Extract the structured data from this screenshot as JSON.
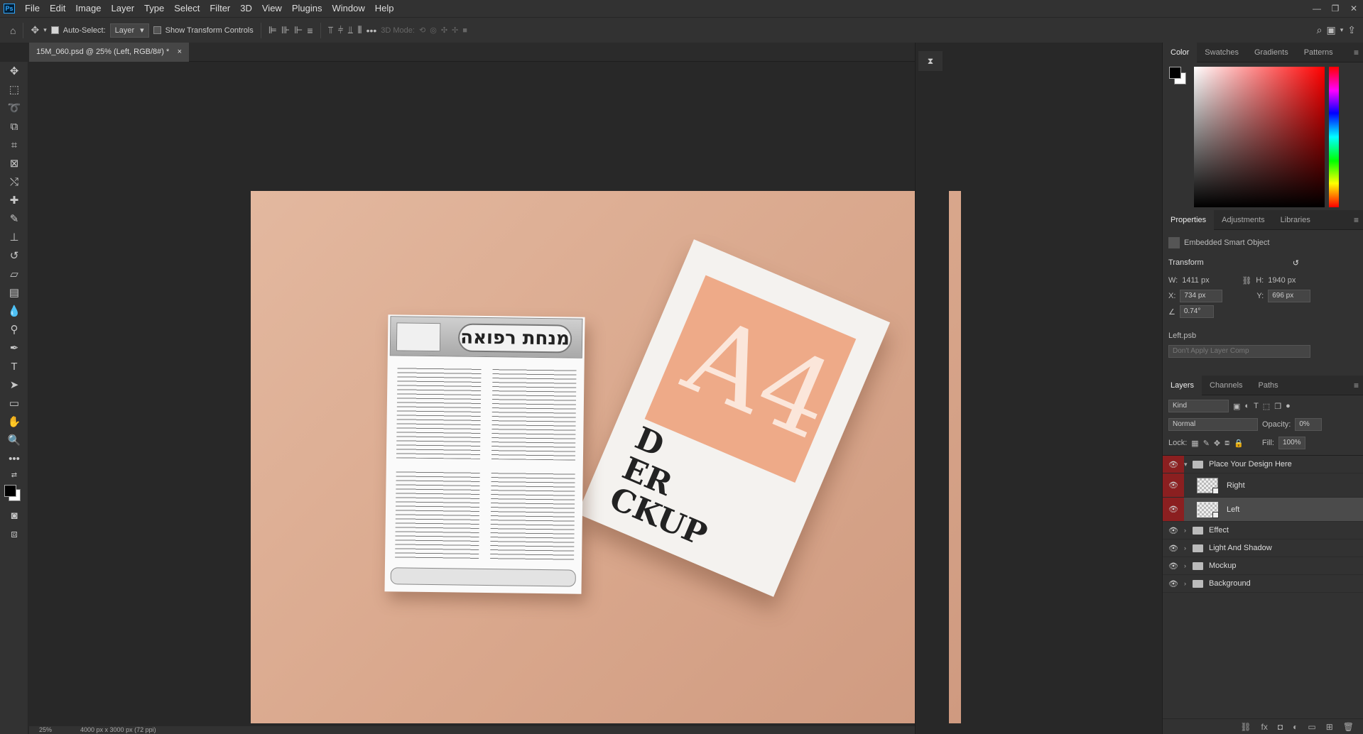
{
  "menubar": {
    "items": [
      "File",
      "Edit",
      "Image",
      "Layer",
      "Type",
      "Select",
      "Filter",
      "3D",
      "View",
      "Plugins",
      "Window",
      "Help"
    ],
    "logo": "Ps"
  },
  "options": {
    "auto_select_label": "Auto-Select:",
    "auto_select_checked": true,
    "target_value": "Layer",
    "show_transform_label": "Show Transform Controls",
    "show_transform_checked": false,
    "mode_3d_label": "3D Mode:",
    "more": "•••"
  },
  "document": {
    "tab_title": "15M_060.psd @ 25% (Left, RGB/8#) *",
    "zoom": "25%",
    "size_info": "4000 px x 3000 px (72 ppi)"
  },
  "mockup": {
    "flyer_title": "מנחת רפואה",
    "a4_text": "A4",
    "back_words": [
      "D",
      "ER",
      "CKUP"
    ]
  },
  "color_panel": {
    "tabs": [
      "Color",
      "Swatches",
      "Gradients",
      "Patterns"
    ],
    "active_tab": "Color",
    "foreground": "#000000",
    "background": "#ffffff",
    "picker_hue": "#ff0000"
  },
  "properties": {
    "tabs": [
      "Properties",
      "Adjustments",
      "Libraries"
    ],
    "active_tab": "Properties",
    "kind_label": "Embedded Smart Object",
    "transform_label": "Transform",
    "w_label": "W:",
    "w_value": "1411 px",
    "h_label": "H:",
    "h_value": "1940 px",
    "x_label": "X:",
    "x_value": "734 px",
    "y_label": "Y:",
    "y_value": "696 px",
    "angle_value": "0.74°",
    "file_name": "Left.psb",
    "layer_comp": "Don't Apply Layer Comp"
  },
  "layers": {
    "tabs": [
      "Layers",
      "Channels",
      "Paths"
    ],
    "active_tab": "Layers",
    "filter_kind": "Kind",
    "blend_mode": "Normal",
    "opacity_label": "Opacity:",
    "opacity_value": "0%",
    "lock_label": "Lock:",
    "fill_label": "Fill:",
    "fill_value": "100%",
    "items": [
      {
        "name": "Place Your Design Here",
        "type": "group",
        "expanded": true
      },
      {
        "name": "Right",
        "type": "smart",
        "indent": true
      },
      {
        "name": "Left",
        "type": "smart",
        "indent": true,
        "selected": true
      },
      {
        "name": "Effect",
        "type": "group"
      },
      {
        "name": "Light And Shadow",
        "type": "group"
      },
      {
        "name": "Mockup",
        "type": "group"
      },
      {
        "name": "Background",
        "type": "group"
      }
    ]
  }
}
